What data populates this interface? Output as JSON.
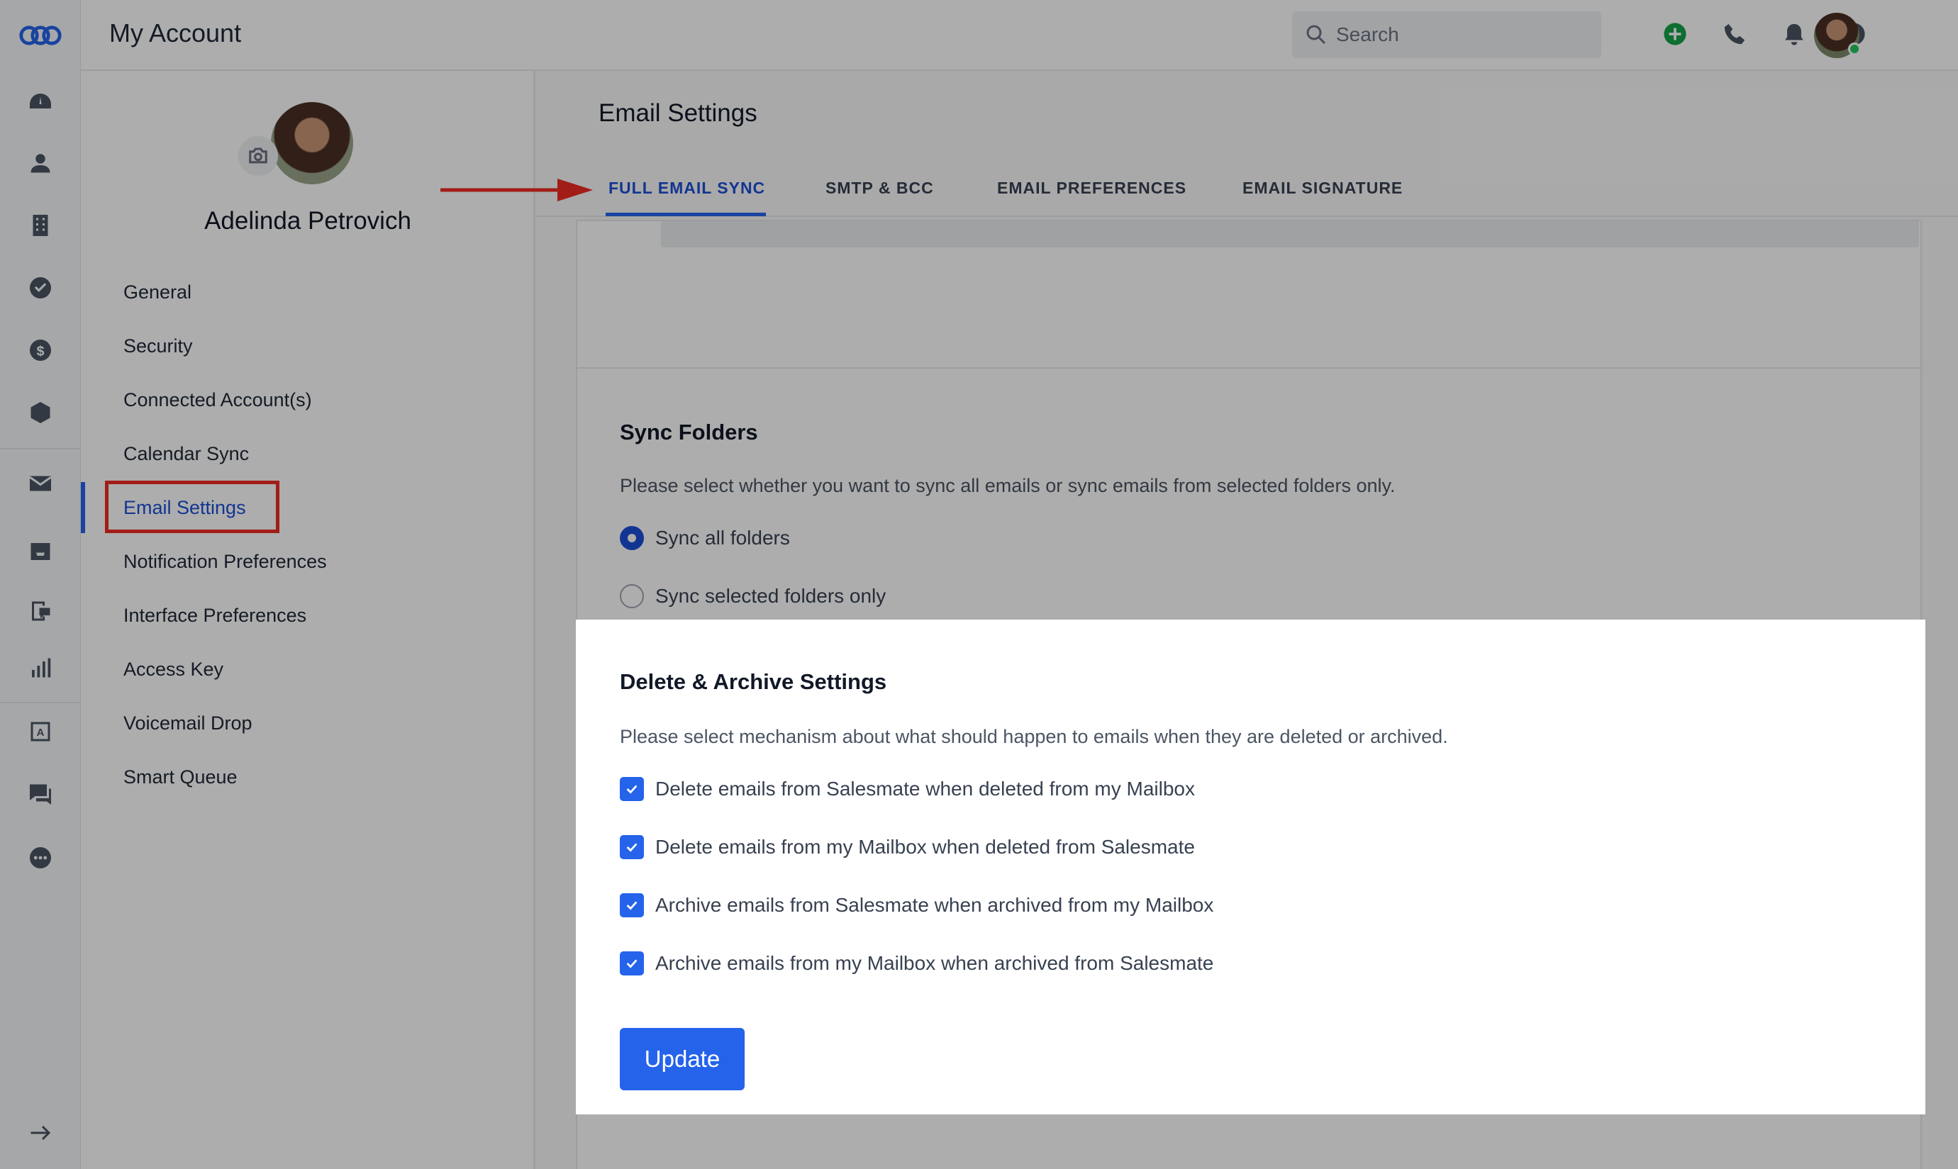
{
  "app": {
    "title": "My Account"
  },
  "search": {
    "placeholder": "Search"
  },
  "rail": {
    "icons": [
      "logo-icon",
      "dashboard-icon",
      "contacts-icon",
      "companies-icon",
      "tasks-icon",
      "deals-icon",
      "products-icon",
      "email-icon",
      "inbox-icon",
      "sequences-icon",
      "reports-icon",
      "automation-icon",
      "chat-icon",
      "more-icon",
      "expand-icon"
    ]
  },
  "topbar_icons": [
    "add-icon",
    "phone-icon",
    "bell-icon",
    "help-icon"
  ],
  "profile": {
    "name": "Adelinda Petrovich"
  },
  "menu": {
    "items": [
      "General",
      "Security",
      "Connected Account(s)",
      "Calendar Sync",
      "Email Settings",
      "Notification Preferences",
      "Interface Preferences",
      "Access Key",
      "Voicemail Drop",
      "Smart Queue"
    ],
    "active": "Email Settings"
  },
  "page": {
    "title": "Email Settings"
  },
  "tabs": {
    "items": [
      "FULL EMAIL SYNC",
      "SMTP & BCC",
      "EMAIL PREFERENCES",
      "EMAIL SIGNATURE"
    ],
    "active": "FULL EMAIL SYNC"
  },
  "sync_folders": {
    "title": "Sync Folders",
    "description": "Please select whether you want to sync all emails or sync emails from selected folders only.",
    "options": [
      "Sync all folders",
      "Sync selected folders only"
    ],
    "selected": "Sync all folders"
  },
  "delete_archive": {
    "title": "Delete & Archive Settings",
    "description": "Please select mechanism about what should happen to emails when they are deleted or archived.",
    "options": [
      "Delete emails from Salesmate when deleted from my Mailbox",
      "Delete emails from my Mailbox when deleted from Salesmate",
      "Archive emails from Salesmate when archived from my Mailbox",
      "Archive emails from my Mailbox when archived from Salesmate"
    ],
    "checked": [
      true,
      true,
      true,
      true
    ],
    "update_label": "Update"
  },
  "colors": {
    "accent": "#2563eb",
    "highlight": "#ef2b22",
    "online": "#22c55e",
    "add": "#16a34a"
  }
}
